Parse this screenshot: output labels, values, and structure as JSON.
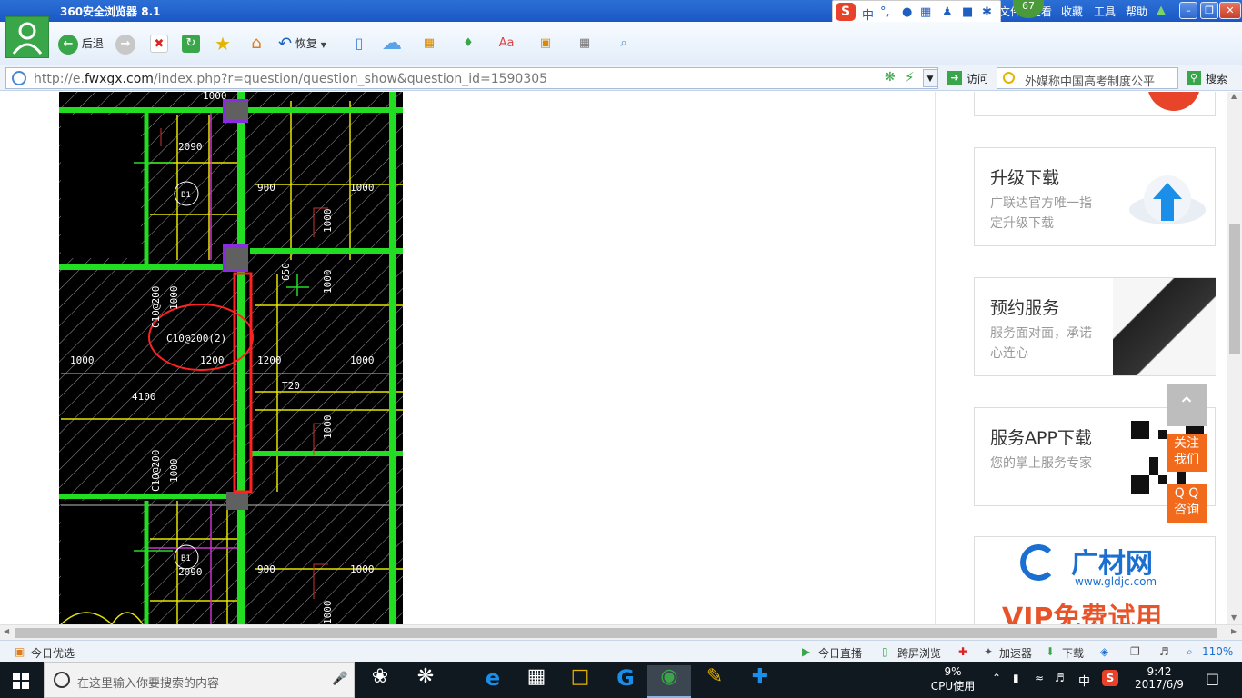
{
  "window": {
    "title": "360安全浏览器 8.1",
    "menu": [
      "文件",
      "查看",
      "收藏",
      "工具",
      "帮助"
    ],
    "notification_count": "67"
  },
  "ime": {
    "lang": "中"
  },
  "toolbar": {
    "back_label": "后退",
    "restore_label": "恢复"
  },
  "address": {
    "url_prefix": "http://e.",
    "url_domain": "fwxgx.com",
    "url_path": "/index.php?r=question/question_show&question_id=1590305",
    "visit_label": "访问",
    "search_value": "外媒称中国高考制度公平",
    "search_label": "搜索"
  },
  "drawing": {
    "dims": [
      "1000",
      "2090",
      "900",
      "1000",
      "1000",
      "650",
      "1000",
      "C10@200",
      "1000",
      "C10@200(2)",
      "1000",
      "1200",
      "1200",
      "1000",
      "4100",
      "T20",
      "1000",
      "C10@200",
      "1000",
      "B1",
      "2090",
      "900",
      "1000",
      "1000",
      "B1",
      "B1"
    ]
  },
  "sidebar": {
    "cards": [
      {
        "title": "升级下载",
        "desc": "广联达官方唯一指定升级下载"
      },
      {
        "title": "预约服务",
        "desc": "服务面对面，承诺心连心"
      },
      {
        "title": "服务APP下载",
        "desc": "您的掌上服务专家"
      }
    ],
    "ad": {
      "brand": "广材网",
      "url": "www.gldjc.com",
      "banner": "VIP免费试用"
    },
    "float": {
      "follow": "关注我们",
      "qq": "Q Q咨询"
    }
  },
  "statusbar": {
    "left": "今日优选",
    "items": [
      "今日直播",
      "跨屏浏览",
      "加速器",
      "下载"
    ],
    "zoom": "110%"
  },
  "taskbar": {
    "search_placeholder": "在这里输入你要搜索的内容",
    "cpu_percent": "9%",
    "cpu_label": "CPU使用",
    "ime": "中",
    "time": "9:42",
    "date": "2017/6/9"
  },
  "colors": {
    "titlebar": "#1b58c4",
    "cad_bg": "#000000",
    "cad_wall": "#22dd22",
    "cad_line": "#e6e600",
    "float_orange": "#f26a1b"
  }
}
